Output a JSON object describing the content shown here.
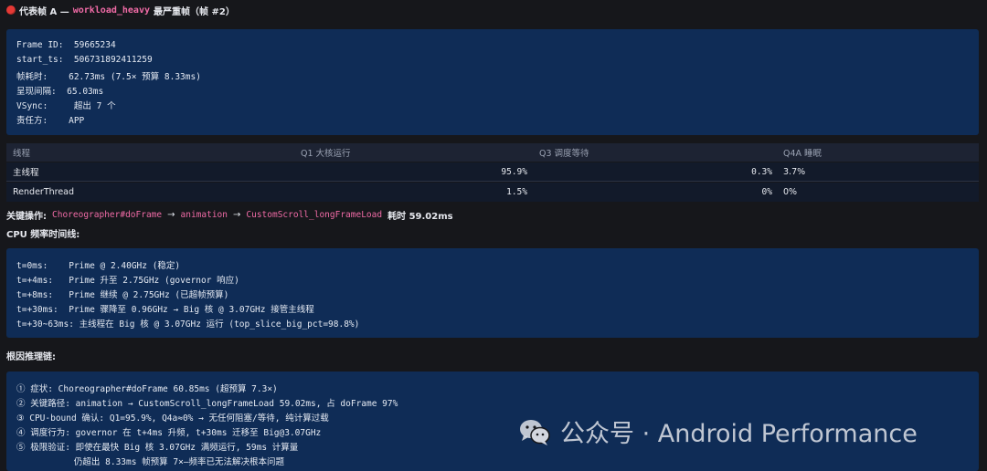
{
  "header": {
    "prefix": "代表帧 A —",
    "workload": "workload_heavy",
    "suffix": "最严重帧（帧 #2）"
  },
  "frame_info": {
    "lines": [
      "Frame ID:  59665234",
      "start_ts:  506731892411259",
      "帧耗时:    62.73ms (7.5× 预算 8.33ms)",
      "呈现间隔:  65.03ms",
      "VSync:     超出 7 个",
      "责任方:    APP"
    ]
  },
  "thread_table": {
    "headers": [
      "线程",
      "Q1 大核运行",
      "Q3 调度等待",
      "Q4A 睡眠"
    ],
    "rows": [
      [
        "主线程",
        "95.9%",
        "0.3%",
        "3.7%"
      ],
      [
        "RenderThread",
        "1.5%",
        "0%",
        "0%"
      ]
    ]
  },
  "key_operation": {
    "label": "关键操作:",
    "steps": [
      "Choreographer#doFrame",
      "animation",
      "CustomScroll_longFrameLoad"
    ],
    "arrow": "→",
    "duration": "耗时 59.02ms"
  },
  "cpu_timeline": {
    "label": "CPU 频率时间线:",
    "lines": [
      "t=0ms:    Prime @ 2.40GHz (稳定)",
      "t=+4ms:   Prime 升至 2.75GHz (governor 响应)",
      "t=+8ms:   Prime 继续 @ 2.75GHz (已超帧预算)",
      "t=+30ms:  Prime 骤降至 0.96GHz → Big 核 @ 3.07GHz 接管主线程",
      "t=+30~63ms: 主线程在 Big 核 @ 3.07GHz 运行 (top_slice_big_pct=98.8%)"
    ]
  },
  "root_cause": {
    "label": "根因推理链:",
    "lines": [
      "① 症状: Choreographer#doFrame 60.85ms (超预算 7.3×)",
      "② 关键路径: animation → CustomScroll_longFrameLoad 59.02ms, 占 doFrame 97%",
      "③ CPU-bound 确认: Q1=95.9%, Q4a≈0% → 无任何阻塞/等待, 纯计算过载",
      "④ 调度行为: governor 在 t+4ms 升频, t+30ms 迁移至 Big@3.07GHz",
      "⑤ 极限验证: 即使在最快 Big 核 3.07GHz 满频运行, 59ms 计算量",
      "           仍超出 8.33ms 帧预算 7×—频率已无法解决根本问题"
    ]
  },
  "watermark": {
    "icon": "wechat-icon",
    "text": "公众号 · Android Performance"
  },
  "colors": {
    "background": "#16171b",
    "panel": "#0f2c56",
    "accent_pink": "#f06ba6",
    "status_red": "#e53935"
  }
}
